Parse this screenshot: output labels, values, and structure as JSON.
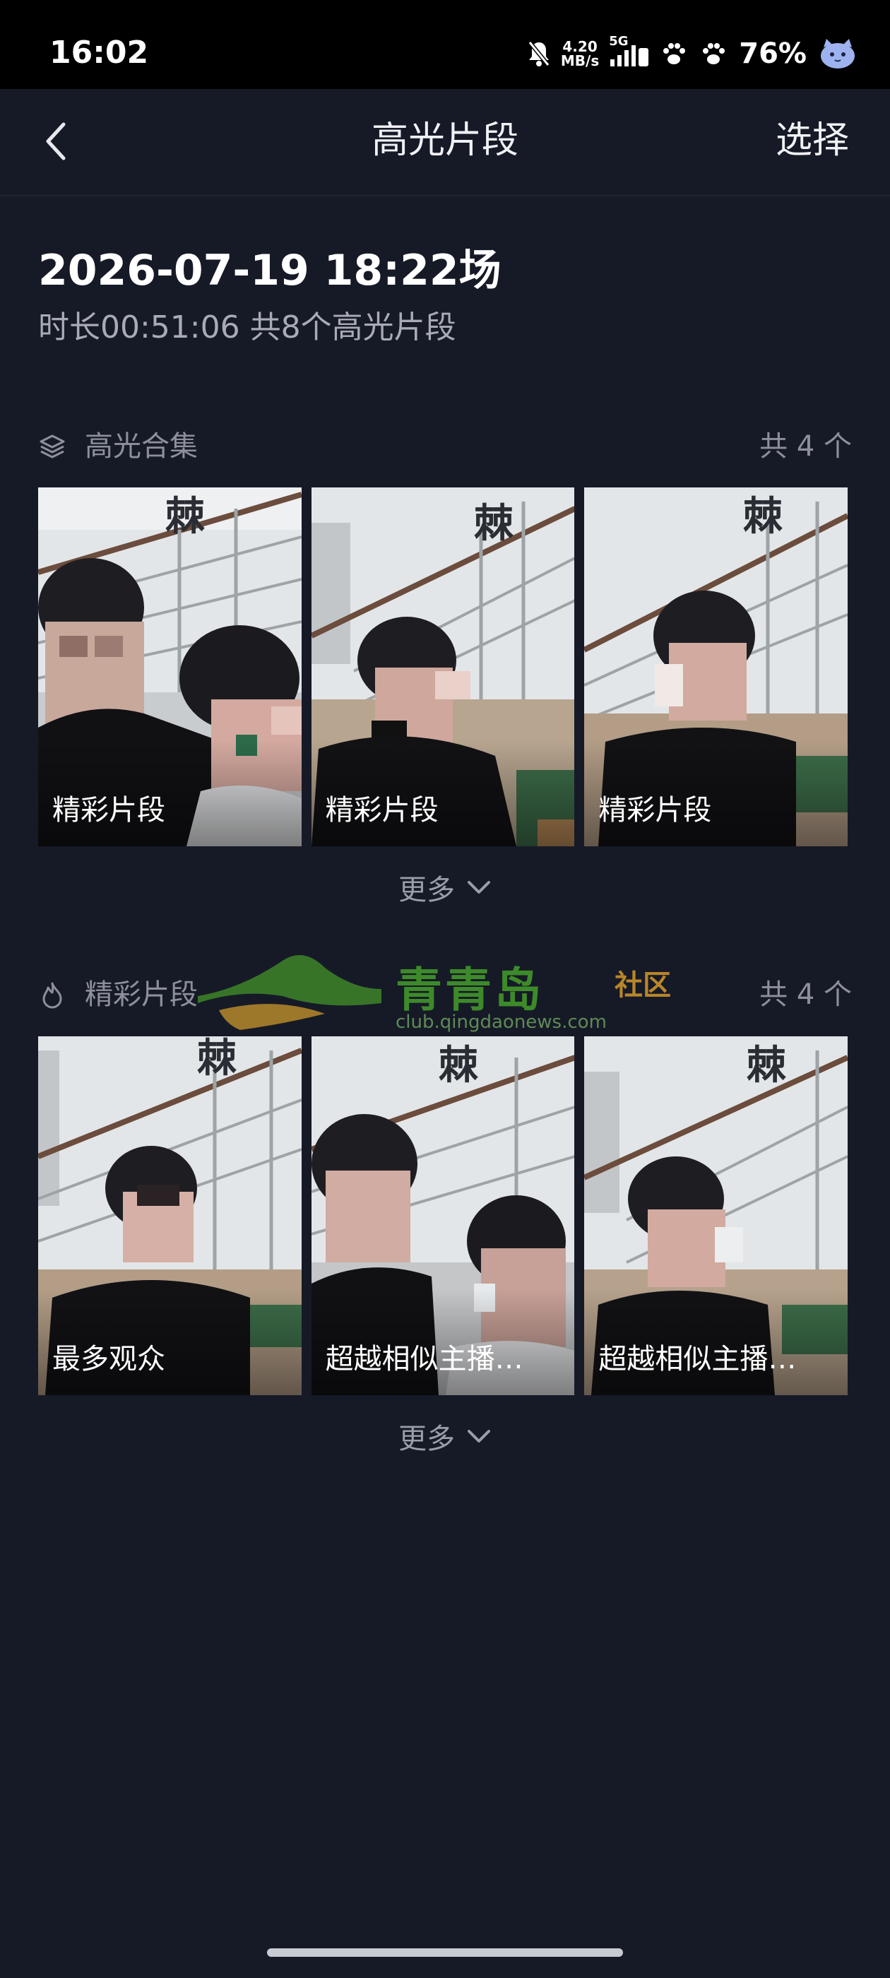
{
  "status_bar": {
    "time": "16:02",
    "net_speed_value": "4.20",
    "net_speed_unit": "MB/s",
    "network_type": "5G",
    "battery": "76%"
  },
  "header": {
    "title": "高光片段",
    "select_label": "选择"
  },
  "session": {
    "title": "2026-07-19 18:22场",
    "duration": "时长00:51:06",
    "count_text": "共8个高光片段"
  },
  "sections": [
    {
      "label": "高光合集",
      "count": "共 4 个",
      "icon": "layers-icon",
      "clips": [
        {
          "caption": "精彩片段"
        },
        {
          "caption": "精彩片段"
        },
        {
          "caption": "精彩片段"
        }
      ],
      "more_label": "更多"
    },
    {
      "label": "精彩片段",
      "count": "共 4 个",
      "icon": "flame-icon",
      "clips": [
        {
          "caption": "最多观众"
        },
        {
          "caption": "超越相似主播…"
        },
        {
          "caption": "超越相似主播…"
        }
      ],
      "more_label": "更多"
    }
  ],
  "watermark": {
    "name": "青青岛",
    "tag": "社区",
    "url": "club.qingdaonews.com"
  },
  "colors": {
    "background": "#161a27",
    "status_bar": "#000000",
    "muted_text": "#8d909c",
    "watermark_green": "#3d8a2a"
  }
}
